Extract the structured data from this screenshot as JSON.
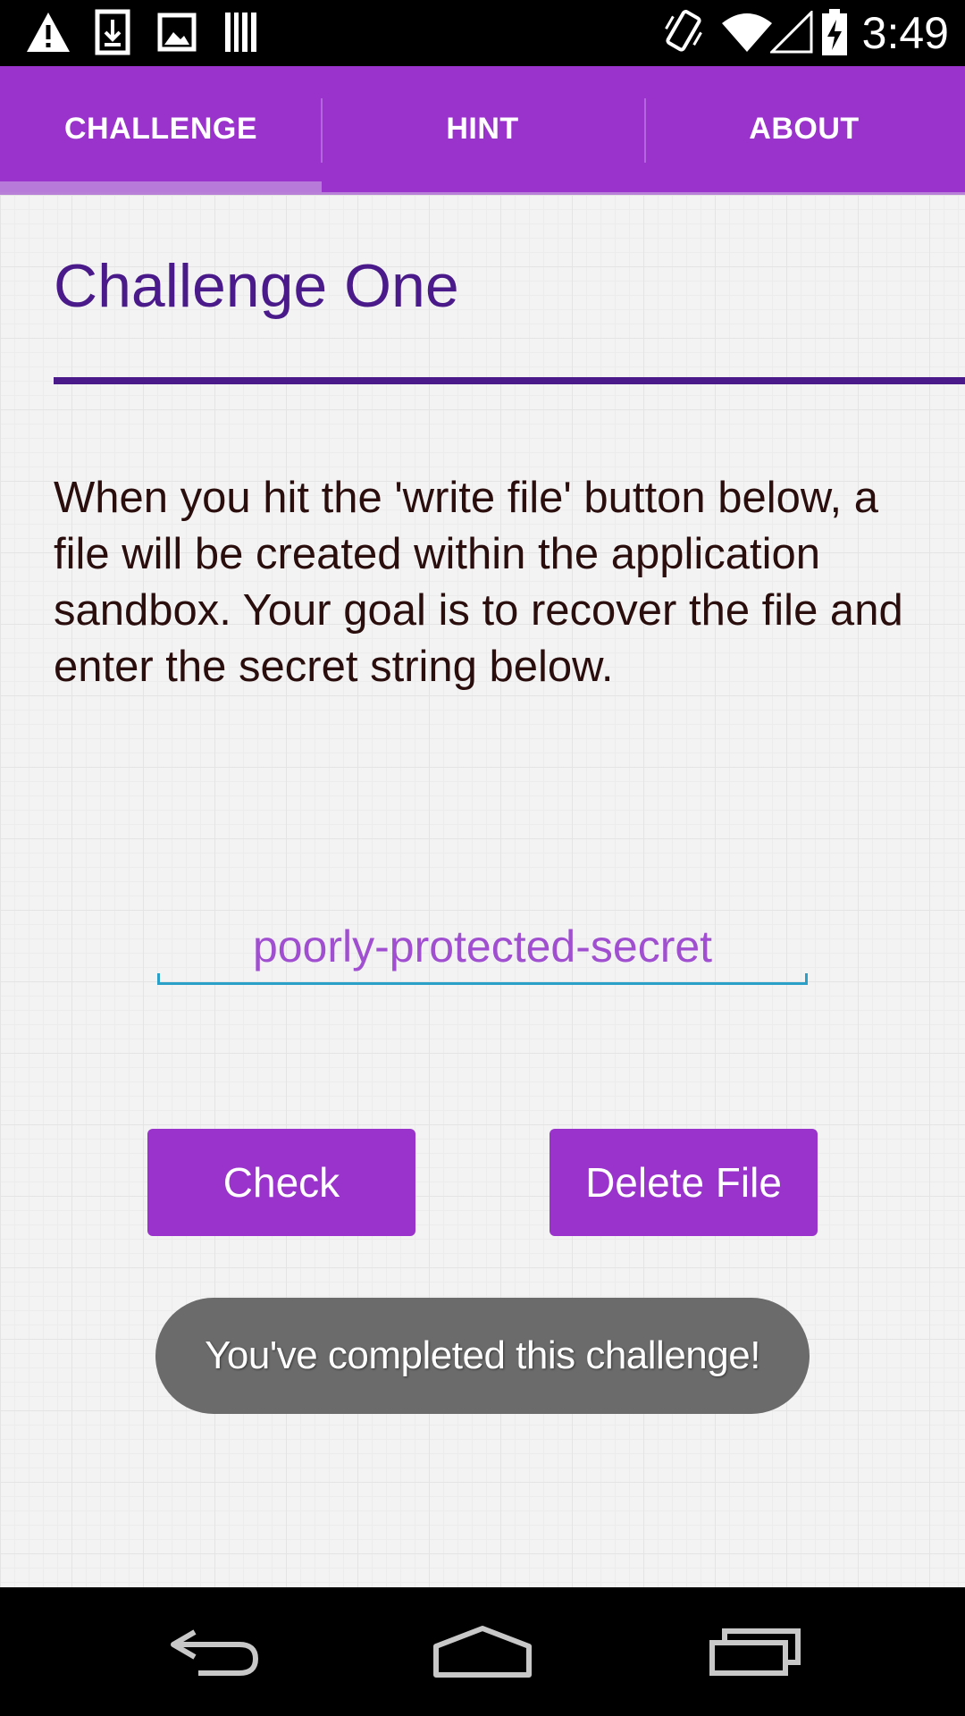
{
  "status_bar": {
    "time": "3:49",
    "notification_icons": [
      "warning-icon",
      "download-icon",
      "image-icon",
      "barcode-icon"
    ],
    "system_icons": [
      "vibrate-icon",
      "wifi-icon",
      "signal-icon",
      "battery-charging-icon"
    ]
  },
  "tabs": [
    {
      "label": "CHALLENGE",
      "selected": true
    },
    {
      "label": "HINT",
      "selected": false
    },
    {
      "label": "ABOUT",
      "selected": false
    }
  ],
  "main": {
    "title": "Challenge One",
    "description": "When you hit the 'write file' button below, a file will be created within the application sandbox. Your goal is to recover the file and enter the secret string below.",
    "secret_input": {
      "value": "poorly-protected-secret"
    },
    "buttons": {
      "check_label": "Check",
      "delete_label": "Delete File"
    },
    "toast": "You've completed this challenge!"
  },
  "nav_bar": {
    "icons": [
      "back-icon",
      "home-icon",
      "recents-icon"
    ]
  },
  "colors": {
    "accent": "#9933cc",
    "title": "#4a1a8a",
    "input_text": "#a04fd0",
    "input_underline": "#2aa0c8",
    "toast_bg": "#6b6b6b"
  }
}
